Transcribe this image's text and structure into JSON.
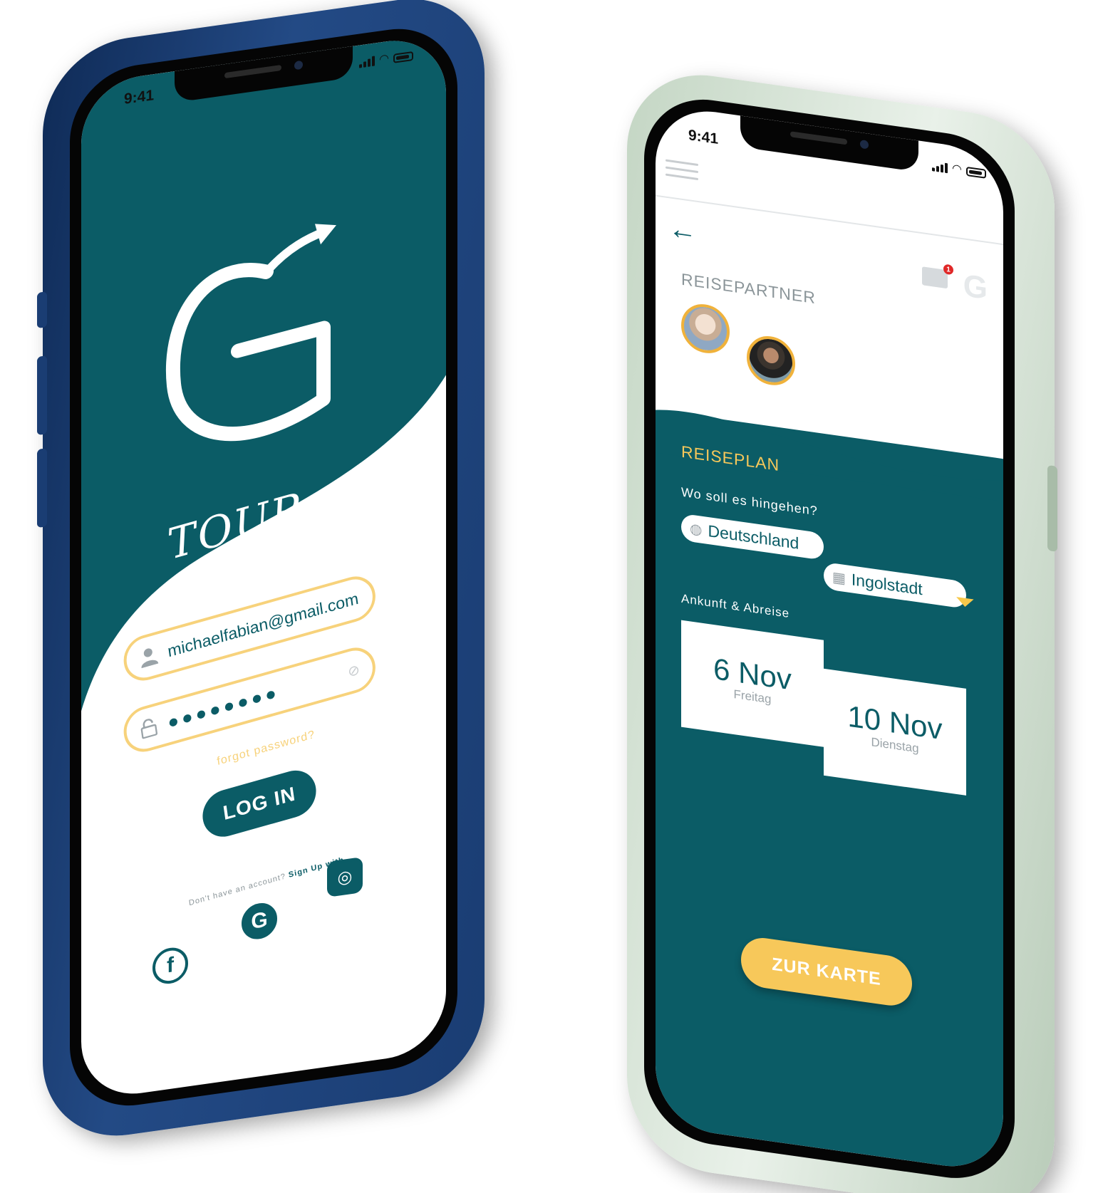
{
  "left_phone": {
    "status_time": "9:41",
    "brand": "TOUR gether",
    "email_value": "michaelfabian@gmail.com",
    "password_value": "●●●●●●●●",
    "forgot_label": "forgot password?",
    "login_label": "LOG IN",
    "signup_prompt": "Don't have an account?",
    "signup_link": "Sign Up with",
    "social": [
      {
        "name": "facebook",
        "glyph": "f"
      },
      {
        "name": "google",
        "glyph": "G"
      },
      {
        "name": "instagram",
        "glyph": "◎"
      }
    ]
  },
  "right_phone": {
    "status_time": "9:41",
    "mail_badge": "1",
    "partners_title": "REISEPARTNER",
    "plan_title": "REISEPLAN",
    "destination_question": "Wo soll es hingehen?",
    "country": "Deutschland",
    "city": "Ingolstadt",
    "dates_label": "Ankunft & Abreise",
    "arrival_date": "6 Nov",
    "arrival_day": "Freitag",
    "departure_date": "10 Nov",
    "departure_day": "Dienstag",
    "cta_label": "ZUR KARTE"
  },
  "colors": {
    "teal": "#0b5c66",
    "yellow": "#f7c85a",
    "left_body": "#1a3d73",
    "right_body": "#c4d6c4"
  }
}
